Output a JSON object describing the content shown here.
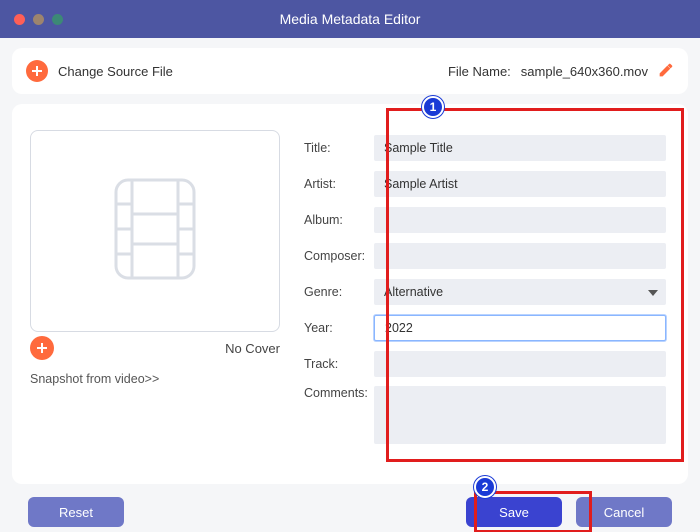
{
  "window": {
    "title": "Media Metadata Editor"
  },
  "topbar": {
    "change_source_label": "Change Source File",
    "file_name_label": "File Name:",
    "file_name_value": "sample_640x360.mov"
  },
  "cover": {
    "no_cover_label": "No Cover",
    "snapshot_link": "Snapshot from video>>"
  },
  "form": {
    "title_label": "Title:",
    "title_value": "Sample Title",
    "artist_label": "Artist:",
    "artist_value": "Sample Artist",
    "album_label": "Album:",
    "album_value": "",
    "composer_label": "Composer:",
    "composer_value": "",
    "genre_label": "Genre:",
    "genre_value": "Alternative",
    "year_label": "Year:",
    "year_value": "2022",
    "track_label": "Track:",
    "track_value": "",
    "comments_label": "Comments:",
    "comments_value": ""
  },
  "footer": {
    "reset_label": "Reset",
    "save_label": "Save",
    "cancel_label": "Cancel"
  },
  "annotations": {
    "badge1": "1",
    "badge2": "2"
  }
}
